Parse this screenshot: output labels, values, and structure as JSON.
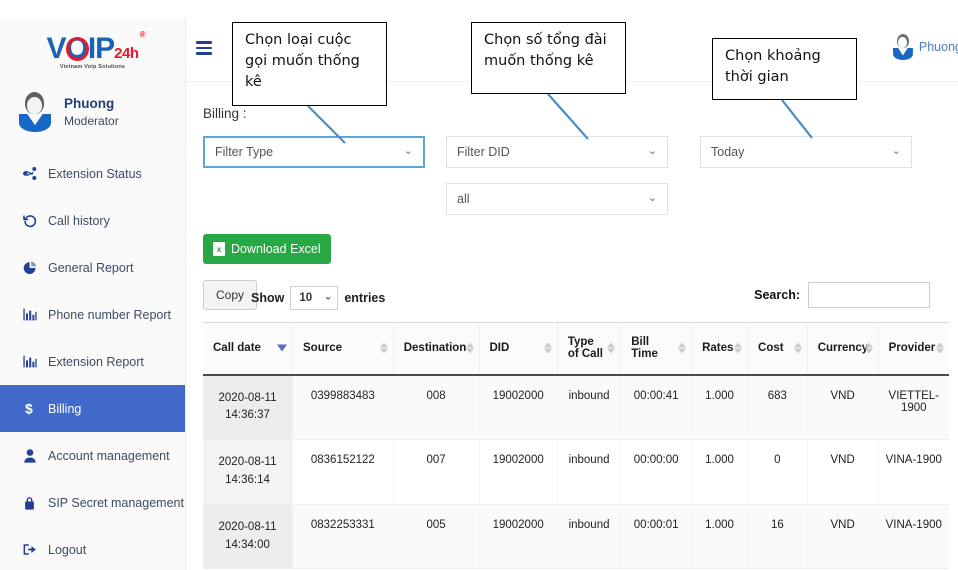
{
  "brand": {
    "logo_v": "V",
    "logo_o": "O",
    "logo_ip": "IP",
    "logo_24h": "24h",
    "logo_reg": "®",
    "tagline": "Vietnam Voip Solutions"
  },
  "sidebar": {
    "user": {
      "name": "Phuong",
      "role": "Moderator",
      "avatar": "user-avatar-icon"
    },
    "items": [
      {
        "label": "Extension Status",
        "icon": "share-nodes-icon",
        "active": false
      },
      {
        "label": "Call history",
        "icon": "history-clock-icon",
        "active": false
      },
      {
        "label": "General Report",
        "icon": "pie-chart-icon",
        "active": false
      },
      {
        "label": "Phone number Report",
        "icon": "bar-chart-icon",
        "active": false
      },
      {
        "label": "Extension Report",
        "icon": "bar-chart-icon",
        "active": false
      },
      {
        "label": "Billing",
        "icon": "dollar-sign-icon",
        "active": true
      },
      {
        "label": "Account management",
        "icon": "person-icon",
        "active": false
      },
      {
        "label": "SIP Secret management",
        "icon": "lock-icon",
        "active": false
      },
      {
        "label": "Logout",
        "icon": "logout-arrow-icon",
        "active": false
      }
    ]
  },
  "topbar": {
    "menu_icon": "hamburger-icon",
    "username": "Phuong"
  },
  "main": {
    "page_label": "Billing :",
    "filters": {
      "type": {
        "value": "Filter Type",
        "caret": "⌄"
      },
      "did": {
        "value": "Filter DID",
        "caret": "⌄"
      },
      "scope": {
        "value": "all",
        "caret": "⌄"
      },
      "period": {
        "value": "Today",
        "caret": "⌄"
      }
    },
    "download_button": {
      "label": "Download Excel",
      "icon_letter": "x"
    },
    "copy_button": "Copy",
    "show_label": "Show",
    "entries_label": "entries",
    "page_length": "10",
    "search_label": "Search:",
    "search_value": "",
    "search_placeholder": ""
  },
  "table": {
    "columns": [
      {
        "label": "Call date",
        "sort": "desc"
      },
      {
        "label": "Source",
        "sort": "none"
      },
      {
        "label": "Destination",
        "sort": "none"
      },
      {
        "label": "DID",
        "sort": "none"
      },
      {
        "label": "Type of Call",
        "sort": "none"
      },
      {
        "label": "Bill Time",
        "sort": "none"
      },
      {
        "label": "Rates",
        "sort": "none"
      },
      {
        "label": "Cost",
        "sort": "none"
      },
      {
        "label": "Currency",
        "sort": "none"
      },
      {
        "label": "Provider",
        "sort": "none"
      }
    ],
    "rows": [
      {
        "call_date": "2020-08-11 14:36:37",
        "source": "0399883483",
        "destination": "008",
        "did": "19002000",
        "type_of_call": "inbound",
        "bill_time": "00:00:41",
        "rates": "1.000",
        "cost": "683",
        "currency": "VND",
        "provider": "VIETTEL-1900"
      },
      {
        "call_date": "2020-08-11 14:36:14",
        "source": "0836152122",
        "destination": "007",
        "did": "19002000",
        "type_of_call": "inbound",
        "bill_time": "00:00:00",
        "rates": "1.000",
        "cost": "0",
        "currency": "VND",
        "provider": "VINA-1900"
      },
      {
        "call_date": "2020-08-11 14:34:00",
        "source": "0832253331",
        "destination": "005",
        "did": "19002000",
        "type_of_call": "inbound",
        "bill_time": "00:00:01",
        "rates": "1.000",
        "cost": "16",
        "currency": "VND",
        "provider": "VINA-1900"
      }
    ]
  },
  "annotations": [
    {
      "text": "Chọn loại cuộc gọi muốn thống kê"
    },
    {
      "text": "Chọn số tổng đài muốn thống kê"
    },
    {
      "text": "Chọn khoảng thời gian"
    }
  ],
  "colors": {
    "sidebar_active": "#4169c9",
    "brand_blue": "#1a62b5",
    "brand_red": "#e8172a",
    "excel_green": "#28a745",
    "leader_line": "#4a8cc7",
    "sort_active": "#5c6bc0"
  }
}
